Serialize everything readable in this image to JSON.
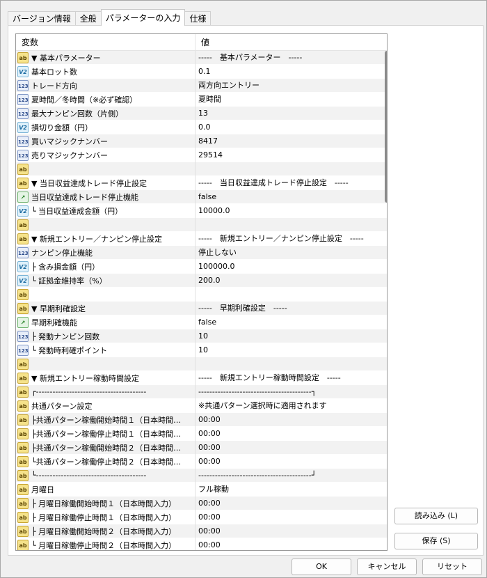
{
  "tabs": [
    {
      "label": "バージョン情報"
    },
    {
      "label": "全般"
    },
    {
      "label": "パラメーターの入力"
    },
    {
      "label": "仕様"
    }
  ],
  "grid": {
    "col_variable": "変数",
    "col_value": "値",
    "rows": [
      {
        "icon": "ab",
        "name": "▼ 基本パラメーター",
        "value": "-----　基本パラメーター　-----"
      },
      {
        "icon": "v2",
        "name": "基本ロット数",
        "value": "0.1"
      },
      {
        "icon": "123",
        "name": "トレード方向",
        "value": "両方向エントリー"
      },
      {
        "icon": "123",
        "name": "夏時間／冬時間（※必ず確認）",
        "value": "夏時間"
      },
      {
        "icon": "123",
        "name": "最大ナンピン回数（片側）",
        "value": "13"
      },
      {
        "icon": "v2",
        "name": "損切り金額（円）",
        "value": "0.0"
      },
      {
        "icon": "123",
        "name": "買いマジックナンバー",
        "value": "8417"
      },
      {
        "icon": "123",
        "name": "売りマジックナンバー",
        "value": "29514"
      },
      {
        "icon": "ab",
        "name": "",
        "value": ""
      },
      {
        "icon": "ab",
        "name": "▼ 当日収益達成トレード停止設定",
        "value": "-----　当日収益達成トレード停止設定　-----"
      },
      {
        "icon": "bool",
        "name": "当日収益達成トレード停止機能",
        "value": "false"
      },
      {
        "icon": "v2",
        "name": "└ 当日収益達成金額（円）",
        "value": "10000.0"
      },
      {
        "icon": "ab",
        "name": "",
        "value": ""
      },
      {
        "icon": "ab",
        "name": "▼ 新規エントリー／ナンピン停止設定",
        "value": "-----　新規エントリー／ナンピン停止設定　-----"
      },
      {
        "icon": "123",
        "name": "ナンピン停止機能",
        "value": "停止しない"
      },
      {
        "icon": "v2",
        "name": "├ 含み損金額（円）",
        "value": "100000.0"
      },
      {
        "icon": "v2",
        "name": "└ 証拠金維持率（%）",
        "value": "200.0"
      },
      {
        "icon": "ab",
        "name": "",
        "value": ""
      },
      {
        "icon": "ab",
        "name": "▼ 早期利確設定",
        "value": "-----　早期利確設定　-----"
      },
      {
        "icon": "bool",
        "name": "早期利確機能",
        "value": "false"
      },
      {
        "icon": "123",
        "name": "├ 発動ナンピン回数",
        "value": "10"
      },
      {
        "icon": "123",
        "name": "└ 発動時利確ポイント",
        "value": "10"
      },
      {
        "icon": "ab",
        "name": "",
        "value": ""
      },
      {
        "icon": "ab",
        "name": "▼ 新規エントリー稼動時間設定",
        "value": "-----　新規エントリー稼動時間設定　-----"
      },
      {
        "icon": "ab",
        "name": "┌----------------------------------------",
        "value": "-----------------------------------------┐"
      },
      {
        "icon": "ab",
        "name": "共通パターン設定",
        "value": "※共通パターン選択時に適用されます"
      },
      {
        "icon": "ab",
        "name": "├共通パターン稼働開始時間１（日本時間…",
        "value": "00:00"
      },
      {
        "icon": "ab",
        "name": "├共通パターン稼働停止時間１（日本時間…",
        "value": "00:00"
      },
      {
        "icon": "ab",
        "name": "├共通パターン稼働開始時間２（日本時間…",
        "value": "00:00"
      },
      {
        "icon": "ab",
        "name": "└共通パターン稼働停止時間２（日本時間…",
        "value": "00:00"
      },
      {
        "icon": "ab",
        "name": "└----------------------------------------",
        "value": "-----------------------------------------┘"
      },
      {
        "icon": "ab",
        "name": "月曜日",
        "value": "フル稼動"
      },
      {
        "icon": "ab",
        "name": "├ 月曜日稼働開始時間１（日本時間入力）",
        "value": "00:00"
      },
      {
        "icon": "ab",
        "name": "├ 月曜日稼働停止時間１（日本時間入力）",
        "value": "00:00"
      },
      {
        "icon": "ab",
        "name": "├ 月曜日稼働開始時間２（日本時間入力）",
        "value": "00:00"
      },
      {
        "icon": "ab",
        "name": "└ 月曜日稼働停止時間２（日本時間入力）",
        "value": "00:00"
      }
    ]
  },
  "icons": {
    "ab": "ab",
    "v2": "V2",
    "123": "123",
    "bool": "↗"
  },
  "buttons": {
    "load": "読み込み (L)",
    "save": "保存 (S)",
    "ok": "OK",
    "cancel": "キャンセル",
    "reset": "リセット"
  }
}
